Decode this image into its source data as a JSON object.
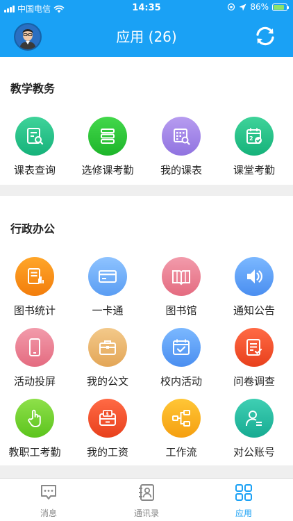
{
  "status": {
    "carrier": "中国电信",
    "time": "14:35",
    "battery": "86%",
    "battery_level": 0.86
  },
  "header": {
    "title": "应用 (26)"
  },
  "sections": [
    {
      "title": "教学教务",
      "apps": [
        "课表查询",
        "选修课考勤",
        "我的课表",
        "课堂考勤"
      ]
    },
    {
      "title": "行政办公",
      "apps": [
        "图书统计",
        "一卡通",
        "图书馆",
        "通知公告",
        "活动投屏",
        "我的公文",
        "校内活动",
        "问卷调查",
        "教职工考勤",
        "我的工资",
        "工作流",
        "对公账号"
      ]
    }
  ],
  "colors": {
    "brand": "#1aa1f5",
    "tab_active": "#1aa1f5",
    "tab_inactive": "#888888"
  },
  "icons": [
    "search-table-icon",
    "layers-icon",
    "calendar-search-icon",
    "calendar-check-icon",
    "report-icon",
    "card-icon",
    "book-icon",
    "speaker-icon",
    "phone-icon",
    "briefcase-icon",
    "calendar-check-icon",
    "list-icon",
    "hand-pointer-icon",
    "wallet-icon",
    "flow-icon",
    "account-icon"
  ],
  "tabs": [
    {
      "label": "消息",
      "icon": "chat-icon"
    },
    {
      "label": "通讯录",
      "icon": "contacts-icon"
    },
    {
      "label": "应用",
      "icon": "apps-grid-icon",
      "active": true
    }
  ]
}
